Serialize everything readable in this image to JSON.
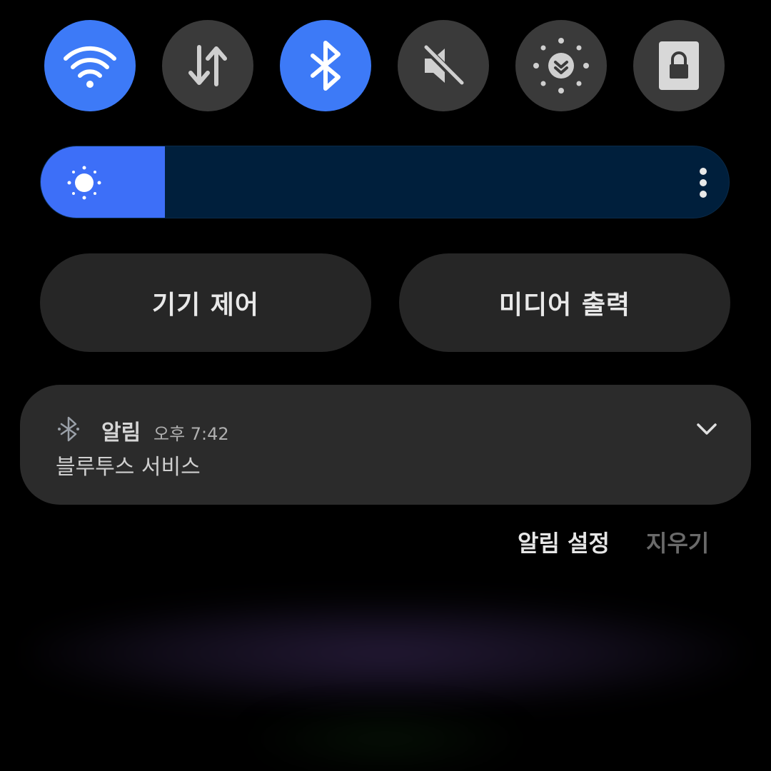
{
  "quick_toggles": [
    {
      "name": "wifi-icon",
      "active": true
    },
    {
      "name": "mobile-data-icon",
      "active": false
    },
    {
      "name": "bluetooth-icon",
      "active": true
    },
    {
      "name": "mute-icon",
      "active": false
    },
    {
      "name": "eye-comfort-icon",
      "active": false
    },
    {
      "name": "secure-folder-icon",
      "active": false
    }
  ],
  "brightness": {
    "level_fraction": 0.18,
    "icon": "sun-icon",
    "menu_icon": "more-vert-icon"
  },
  "panel_buttons": {
    "device_control": "기기 제어",
    "media_output": "미디어 출력"
  },
  "notification": {
    "icon": "bluetooth-icon",
    "app_name": "알림",
    "time": "오후 7:42",
    "body": "블루투스 서비스",
    "expand_icon": "chevron-down-icon"
  },
  "footer": {
    "settings": "알림 설정",
    "clear": "지우기"
  },
  "colors": {
    "accent": "#3d7af7",
    "toggle_off": "#3a3a3a",
    "slider_track": "#001f3c",
    "card": "#2b2b2b",
    "pill": "#262626",
    "clear_disabled": "#6a6a6a"
  }
}
